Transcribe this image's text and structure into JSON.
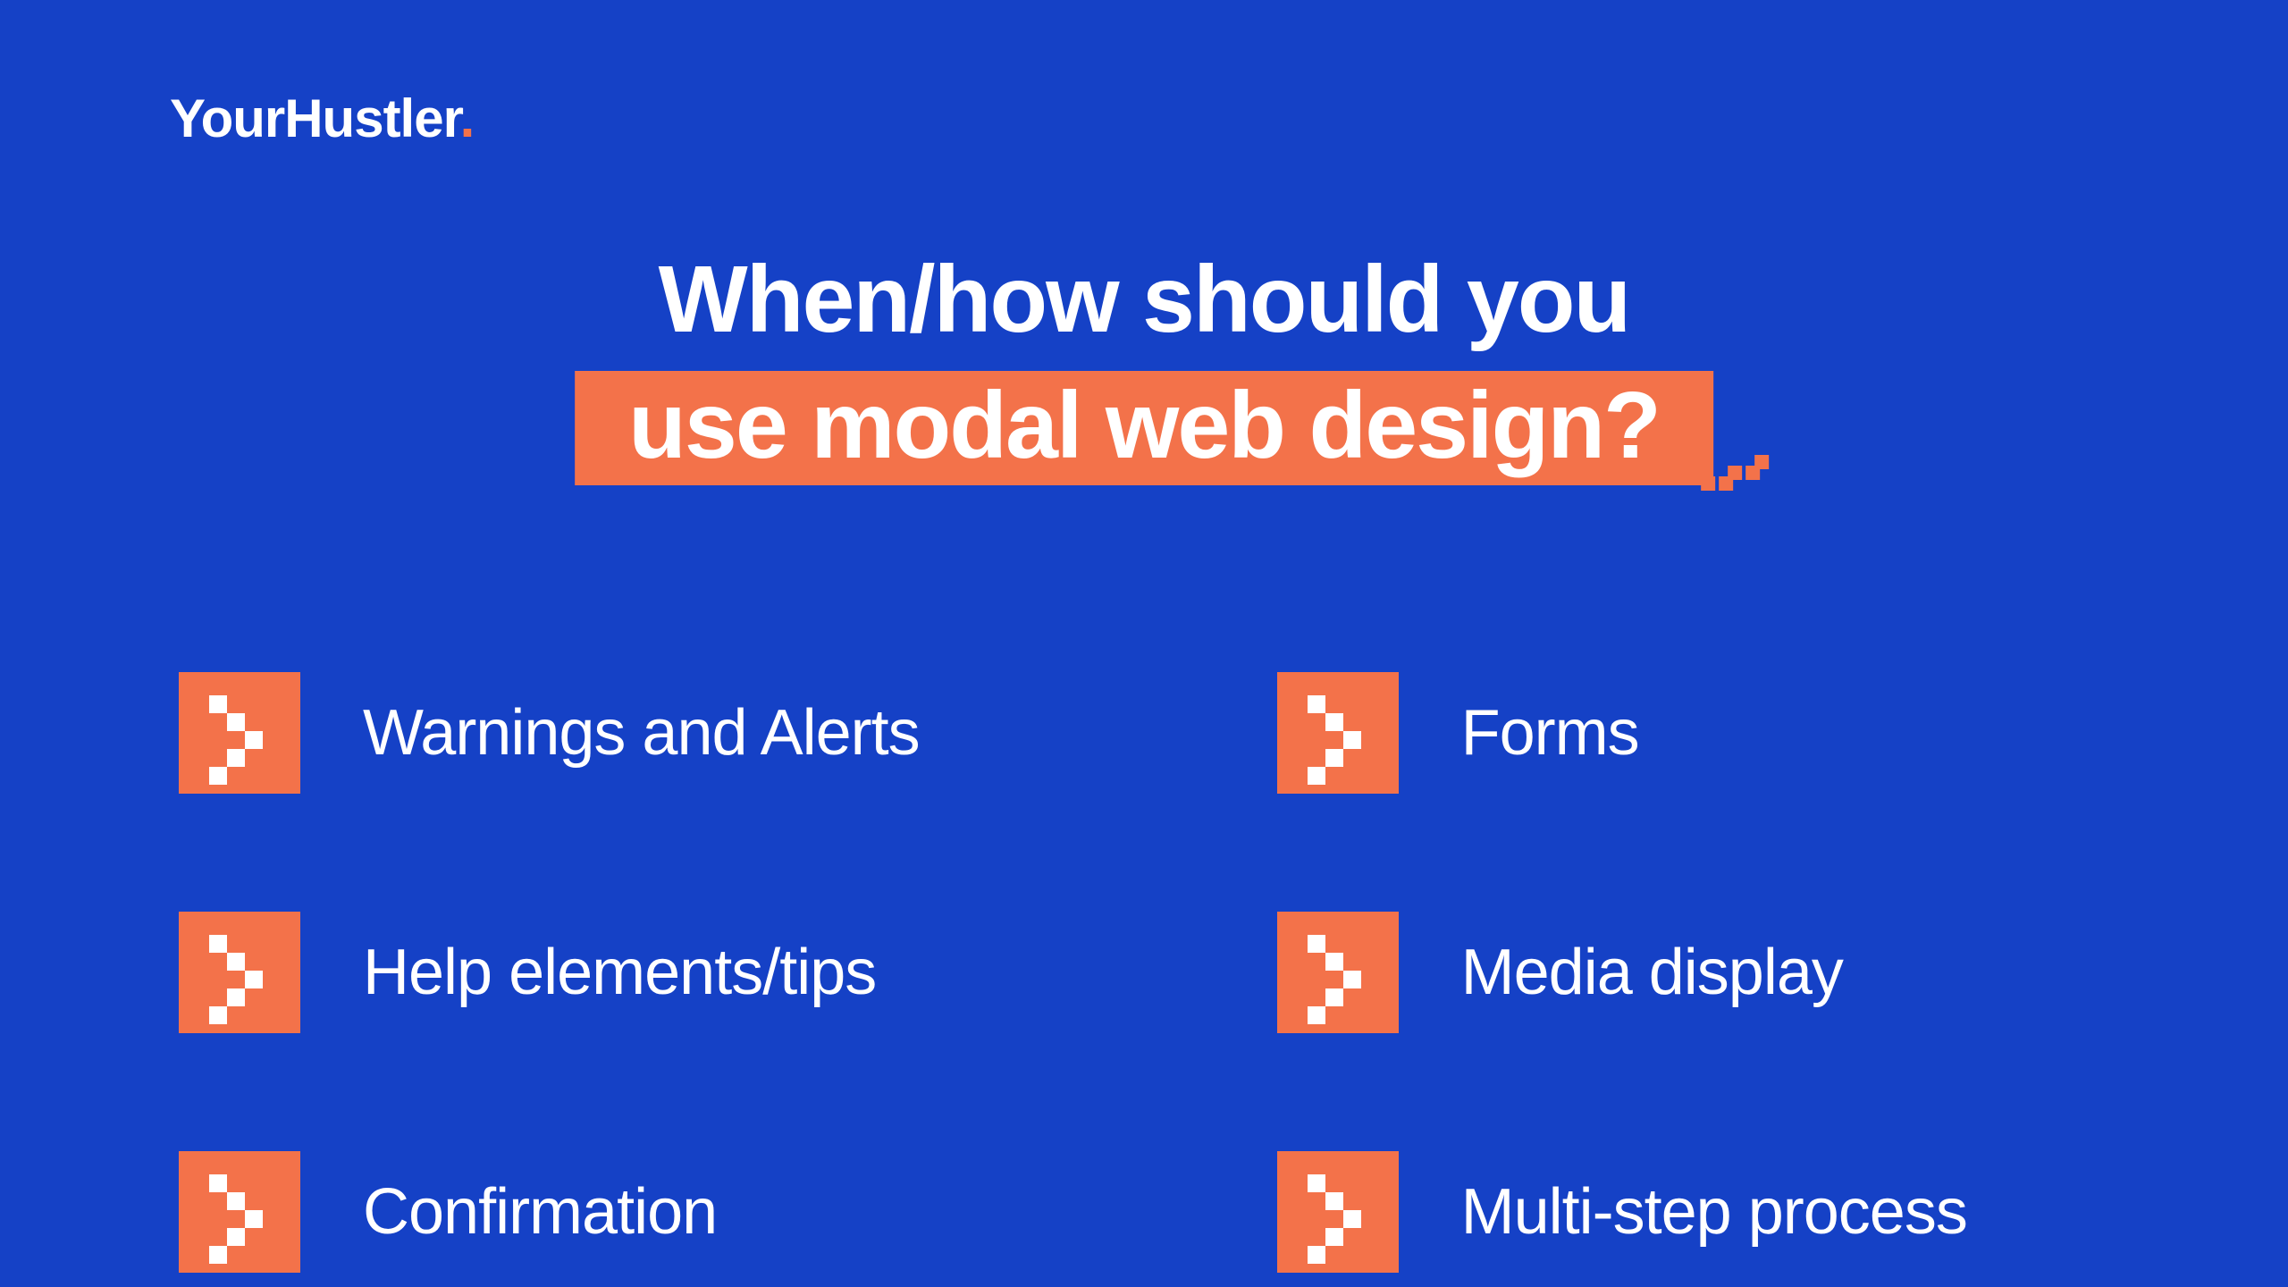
{
  "brand": {
    "name": "YourHustler",
    "accent_glyph": "."
  },
  "colors": {
    "bg": "#1541c6",
    "accent": "#f3724a",
    "text": "#ffffff"
  },
  "title": {
    "line1": "When/how should you",
    "line2": "use modal web design?"
  },
  "bullets": {
    "left": [
      {
        "label": "Warnings and Alerts"
      },
      {
        "label": "Help elements/tips"
      },
      {
        "label": "Confirmation"
      }
    ],
    "right": [
      {
        "label": "Forms"
      },
      {
        "label": "Media display"
      },
      {
        "label": "Multi-step process"
      }
    ]
  }
}
